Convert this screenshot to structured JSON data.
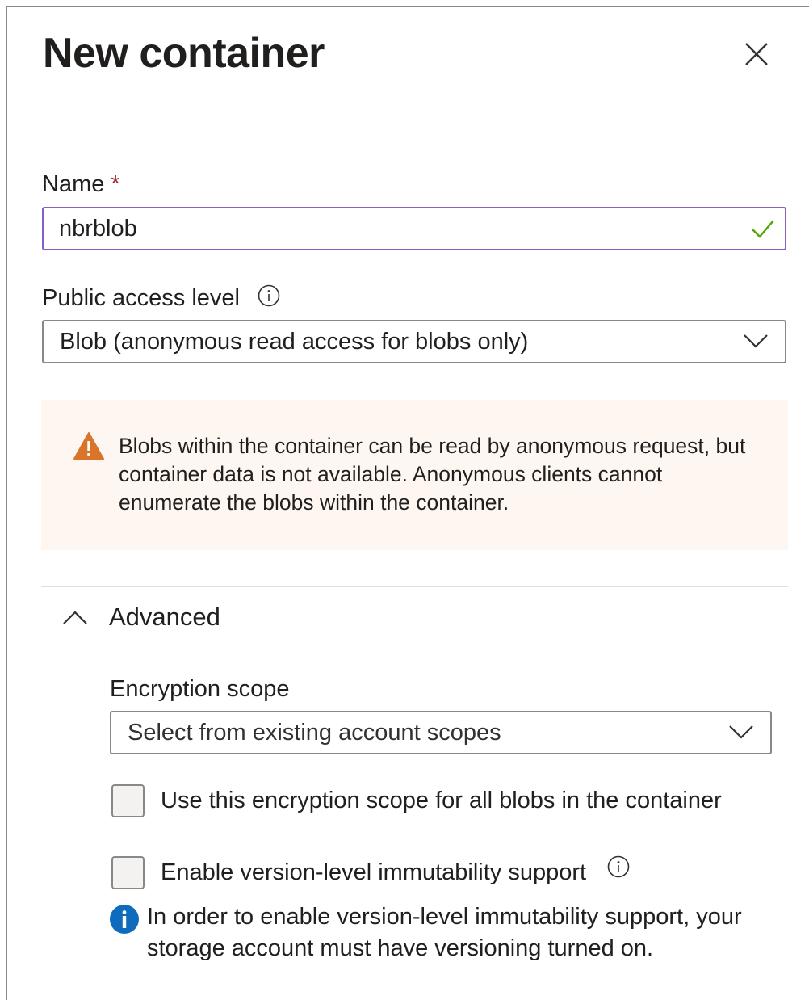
{
  "header": {
    "title": "New container"
  },
  "name_field": {
    "label": "Name",
    "required_marker": "*",
    "value": "nbrblob"
  },
  "access_level": {
    "label": "Public access level",
    "selected": "Blob (anonymous read access for blobs only)"
  },
  "warning": {
    "text": "Blobs within the container can be read by anonymous request, but container data is not available. Anonymous clients cannot enumerate the blobs within the container."
  },
  "advanced": {
    "label": "Advanced",
    "expanded": true,
    "encryption_scope": {
      "label": "Encryption scope",
      "placeholder": "Select from existing account scopes"
    },
    "use_scope_checkbox": {
      "label": "Use this encryption scope for all blobs in the container",
      "checked": false
    },
    "immutability_checkbox": {
      "label": "Enable version-level immutability support",
      "checked": false
    },
    "info_note": "In order to enable version-level immutability support, your storage account must have versioning turned on."
  },
  "colors": {
    "accent_border": "#8661c5",
    "valid_check": "#57a300",
    "warning_icon": "#d97429",
    "warning_bg": "#fdf6f1",
    "info_icon": "#0f6cbd",
    "required": "#a4262c"
  },
  "icons": {
    "close": "close-icon",
    "check": "check-icon",
    "info": "info-circle-icon",
    "chevron_down": "chevron-down-icon",
    "chevron_up": "chevron-up-icon",
    "warning": "warning-triangle-icon",
    "info_filled": "info-filled-icon"
  }
}
